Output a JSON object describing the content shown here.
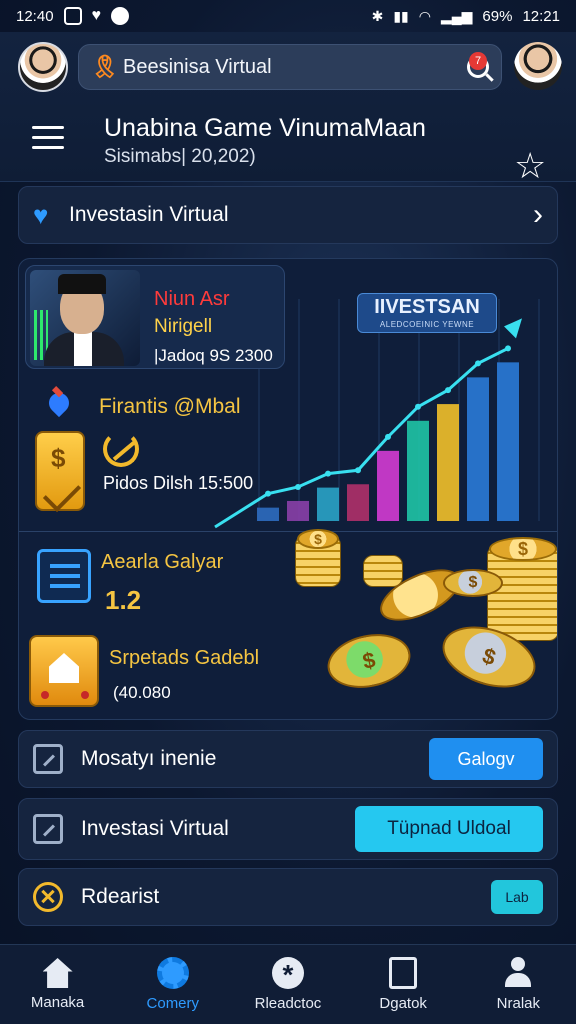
{
  "status_bar": {
    "time_left": "12:40",
    "battery": "69%",
    "time_right": "12:21"
  },
  "header": {
    "search_text": "Beesinisa Virtual",
    "notification_count": "7",
    "title": "Unabina Game VinumaMaan",
    "subtitle": "Sisimabs| 20,202)"
  },
  "section": {
    "label": "Investasin Virtual"
  },
  "card": {
    "profile": {
      "name": "Niun Asr",
      "role": "Nirigell",
      "value": "|Jadoq 9S 2300"
    },
    "badge": {
      "title": "IIVESTSAN",
      "subtitle": "ALEDCOEINIC YEWNE"
    },
    "finance_title": "Firantis @Mbal",
    "profit_text": "Pidos Dilsh 15:500",
    "asset_title": "Aearla Galyar",
    "asset_value": "1.2",
    "earn_title": "Srpetads Gadebl",
    "earn_value": "(40.080"
  },
  "chart_data": {
    "type": "bar",
    "bar_colors": [
      "#2d6cc0",
      "#8a3fa8",
      "#2aa3c8",
      "#b0306a",
      "#d43bd4",
      "#1fc4a6",
      "#f2c02a",
      "#2a7ad8",
      "#2a7ad8"
    ],
    "values": [
      8,
      12,
      20,
      22,
      42,
      60,
      70,
      86,
      95
    ],
    "trend_color": "#39e0f0"
  },
  "actions": [
    {
      "label": "Mosatyı inenie",
      "button": "Galogv"
    },
    {
      "label": "Investasi Virtual",
      "button": "Tüpnad Uldoal"
    },
    {
      "label": "Rdearist",
      "button": "Lab"
    }
  ],
  "nav": [
    {
      "label": "Manaka"
    },
    {
      "label": "Comery"
    },
    {
      "label": "Rleadctoc"
    },
    {
      "label": "Dgatok"
    },
    {
      "label": "Nralak"
    }
  ]
}
